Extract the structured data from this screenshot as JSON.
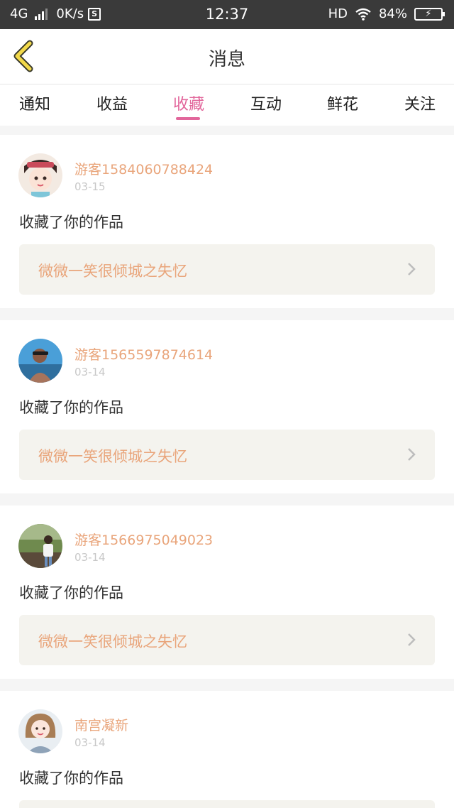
{
  "status": {
    "network": "4G",
    "speed": "0K/s",
    "time": "12:37",
    "hd": "HD",
    "battery": "84%"
  },
  "nav": {
    "title": "消息"
  },
  "tabs": [
    {
      "label": "通知"
    },
    {
      "label": "收益"
    },
    {
      "label": "收藏",
      "active": true
    },
    {
      "label": "互动"
    },
    {
      "label": "鲜花"
    },
    {
      "label": "关注"
    }
  ],
  "messages": [
    {
      "user": "游客1584060788424",
      "date": "03-15",
      "action": "收藏了你的作品",
      "work": "微微一笑很倾城之失忆"
    },
    {
      "user": "游客1565597874614",
      "date": "03-14",
      "action": "收藏了你的作品",
      "work": "微微一笑很倾城之失忆"
    },
    {
      "user": "游客1566975049023",
      "date": "03-14",
      "action": "收藏了你的作品",
      "work": "微微一笑很倾城之失忆"
    },
    {
      "user": "南宫凝新",
      "date": "03-14",
      "action": "收藏了你的作品",
      "work": ""
    }
  ],
  "colors": {
    "accent": "#e2669b",
    "username": "#e9a57b",
    "back_icon": "#f2d94a"
  }
}
